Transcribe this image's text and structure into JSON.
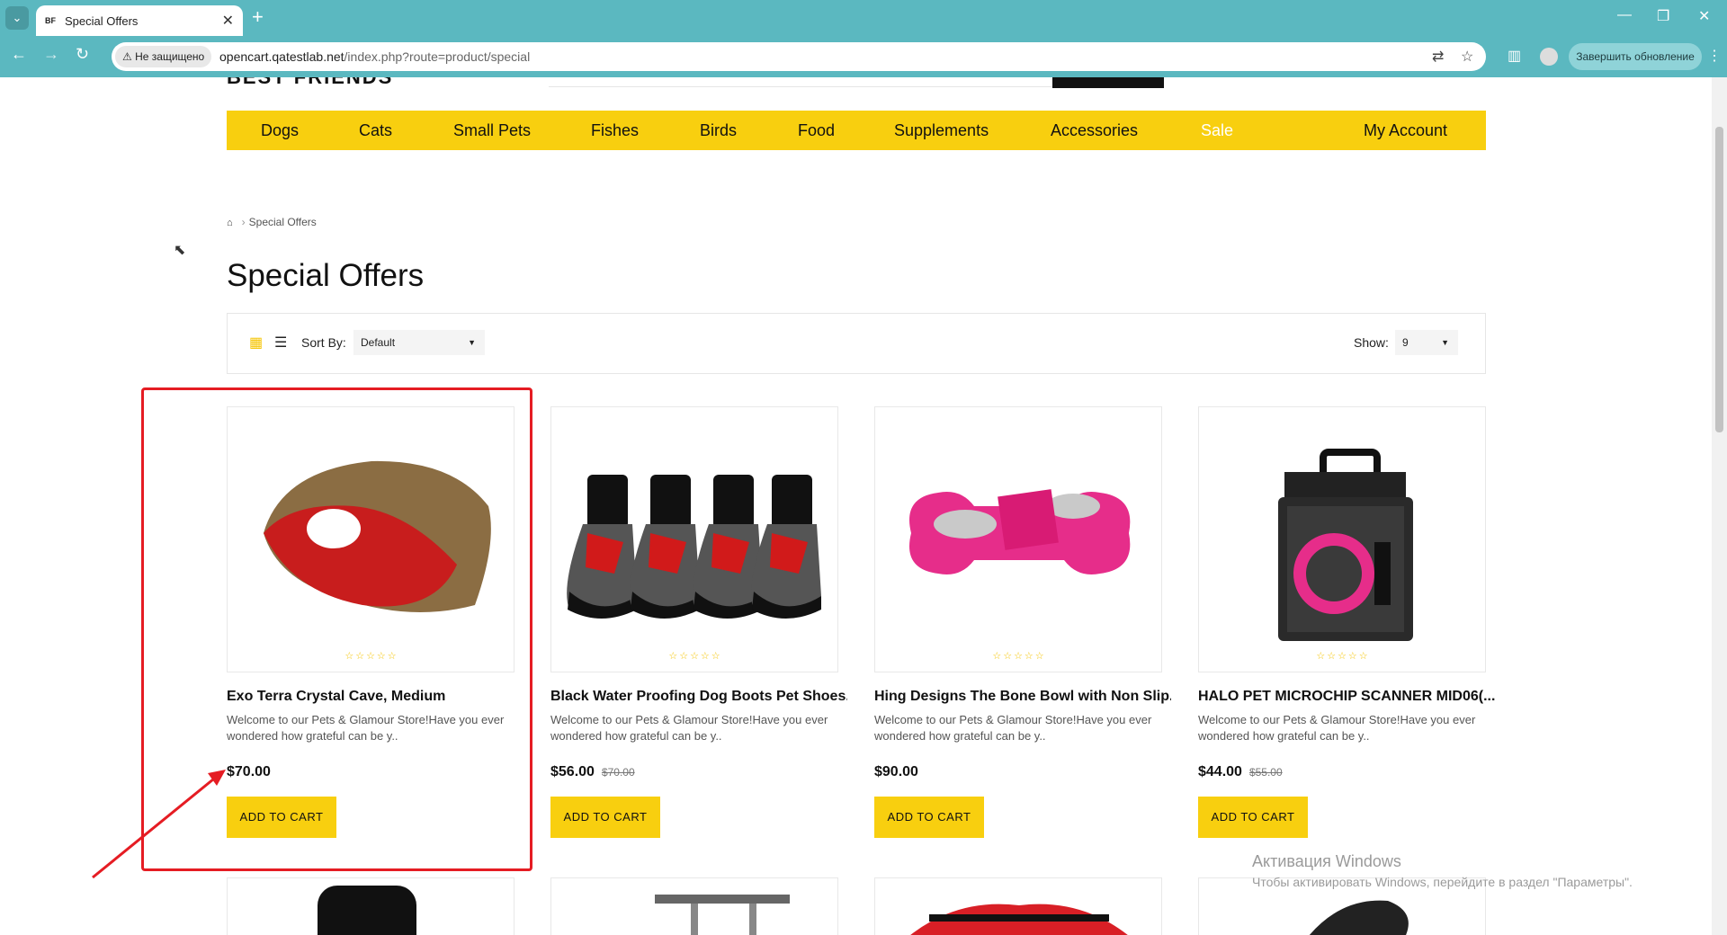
{
  "browser": {
    "tab_title": "Special Offers",
    "favicon_text": "BF",
    "security_label": "Не защищено",
    "url_host": "opencart.qatestlab.net",
    "url_path": "/index.php?route=product/special",
    "update_label": "Завершить обновление"
  },
  "menu": {
    "items": [
      "Dogs",
      "Cats",
      "Small Pets",
      "Fishes",
      "Birds",
      "Food",
      "Supplements",
      "Accessories",
      "Sale"
    ],
    "account": "My Account"
  },
  "breadcrumb": {
    "current": "Special Offers"
  },
  "page_title": "Special Offers",
  "filters": {
    "sort_label": "Sort By:",
    "sort_value": "Default",
    "show_label": "Show:",
    "show_value": "9"
  },
  "products": [
    {
      "name": "Exo Terra Crystal Cave, Medium",
      "description": "Welcome to our Pets & Glamour Store!Have you ever wondered how grateful can be y..",
      "price": "$70.00",
      "old_price": "",
      "cart_label": "ADD TO CART"
    },
    {
      "name": "Black Water Proofing Dog Boots Pet Shoes...",
      "description": "Welcome to our Pets & Glamour Store!Have you ever wondered how grateful can be y..",
      "price": "$56.00",
      "old_price": "$70.00",
      "cart_label": "ADD TO CART"
    },
    {
      "name": "Hing Designs The Bone Bowl with Non Slip...",
      "description": "Welcome to our Pets & Glamour Store!Have you ever wondered how grateful can be y..",
      "price": "$90.00",
      "old_price": "",
      "cart_label": "ADD TO CART"
    },
    {
      "name": "HALO PET MICROCHIP SCANNER MID06(...",
      "description": "Welcome to our Pets & Glamour Store!Have you ever wondered how grateful can be y..",
      "price": "$44.00",
      "old_price": "$55.00",
      "cart_label": "ADD TO CART"
    }
  ],
  "watermark": {
    "line1": "Активация Windows",
    "line2": "Чтобы активировать Windows, перейдите в раздел \"Параметры\"."
  },
  "colors": {
    "accent": "#f8cf0f",
    "chrome": "#5bb8c0",
    "highlight": "#e51c23"
  }
}
